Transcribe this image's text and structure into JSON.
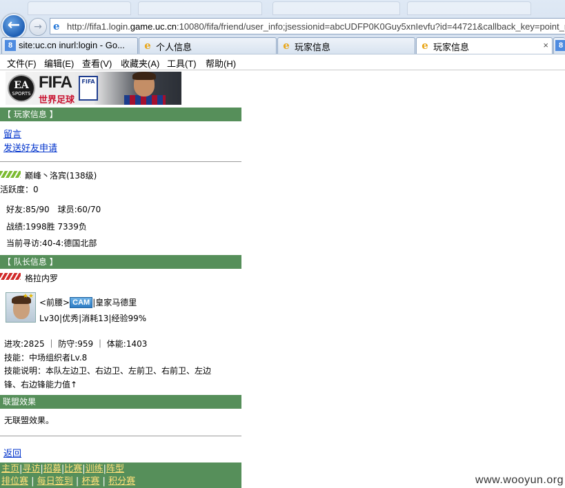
{
  "browser": {
    "address_url_prefix": "http://fifa1.login.",
    "address_url_domain": "game.uc.cn",
    "address_url_suffix": ":10080/fifa/friend/user_info;jsessionid=abcUDFP0K0Guy5xnIevfu?id=44721&callback_key=point_r",
    "tabs": [
      {
        "label": "site:uc.cn inurl:login - Go...",
        "icon": "google-icon"
      },
      {
        "label": "个人信息",
        "icon": "ie-page-icon"
      },
      {
        "label": "玩家信息",
        "icon": "ie-page-icon"
      },
      {
        "label": "玩家信息",
        "icon": "ie-page-icon",
        "active": true
      }
    ],
    "close_glyph": "×",
    "menu": [
      "文件(F)",
      "编辑(E)",
      "查看(V)",
      "收藏夹(A)",
      "工具(T)",
      "帮助(H)"
    ]
  },
  "banner": {
    "ea": "EA",
    "sports": "SPORTS",
    "fifa": "FIFA",
    "subtitle": "世界足球",
    "badge": "FIFA"
  },
  "player_info": {
    "section_title": "【 玩家信息 】",
    "links": [
      "留言",
      "发送好友申请"
    ],
    "name_level": "巅峰丶洛宾(138级)",
    "activity": "活跃度：0",
    "friends_players": "好友:85/90　球员:60/70",
    "record": "战绩:1998胜 7339负",
    "current_visit": "当前寻访:40-4:德国北部"
  },
  "captain_info": {
    "section_title": "【 队长信息 】",
    "name": "格拉内罗",
    "position_prefix": "<前腰>",
    "position_badge": "CAM",
    "club": "|皇家马德里",
    "stats_line": "Lv30|优秀|消耗13|经验99%",
    "attributes": "进攻:2825 ｜ 防守:959 ｜ 体能:1403",
    "skill": "技能：中场组织者Lv.8",
    "skill_desc_line1": "技能说明：本队左边卫、右边卫、左前卫、右前卫、左边",
    "skill_desc_line2": "锋、右边锋能力值↑",
    "avatar_stars": "★★"
  },
  "alliance": {
    "section_title": "联盟效果",
    "text": "无联盟效果。"
  },
  "back_link": "返回",
  "bottom_nav": {
    "row1": [
      "主页",
      "寻访",
      "招募",
      "比赛",
      "训练",
      "阵型"
    ],
    "row2": [
      "排位赛",
      "每日签到",
      "杯赛",
      "积分赛"
    ],
    "sep": "|"
  },
  "watermark": "www.wooyun.org",
  "colors": {
    "section_bar": "#568f5a",
    "link": "#0033cc",
    "bottom_link": "#ffe07a"
  }
}
